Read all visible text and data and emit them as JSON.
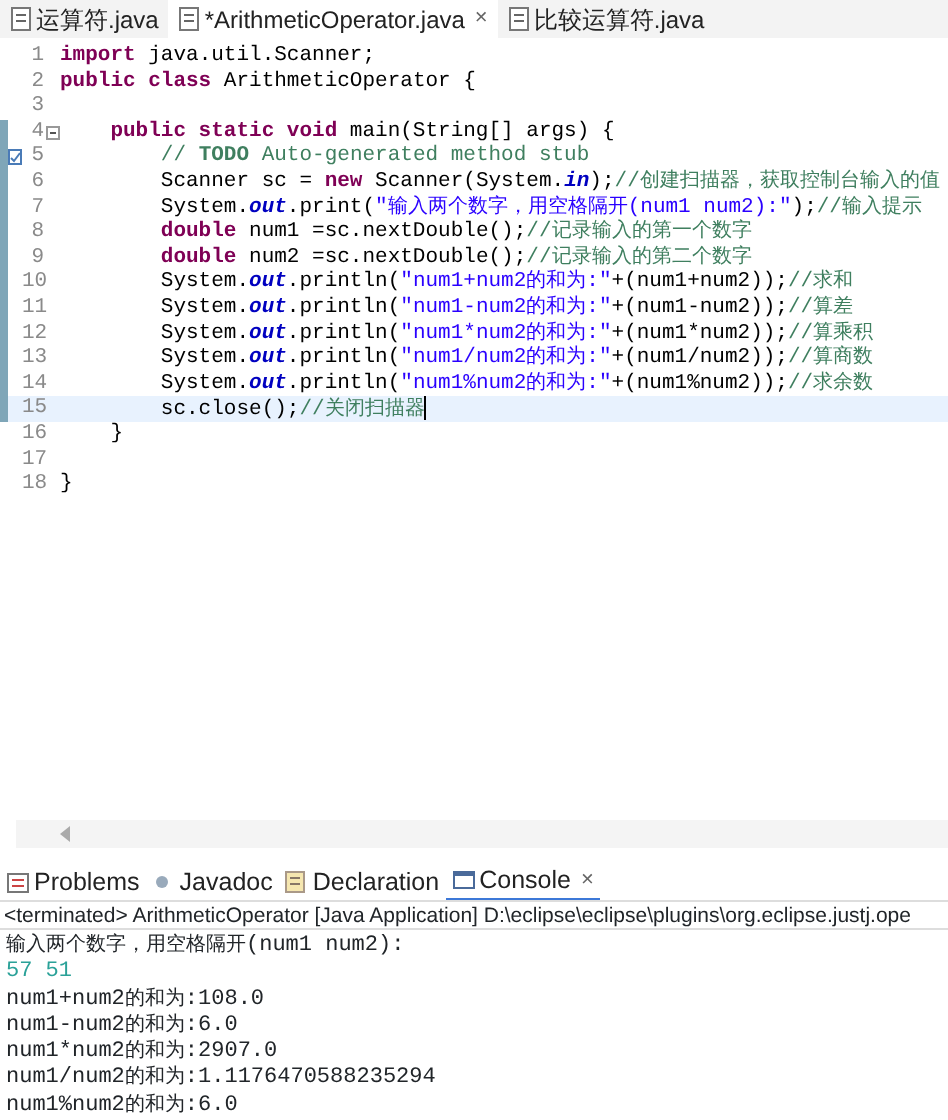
{
  "editor_tabs": [
    {
      "label": "运算符.java",
      "selected": false
    },
    {
      "label": "*ArithmeticOperator.java",
      "selected": true,
      "close": "×"
    },
    {
      "label": "比较运算符.java",
      "selected": false
    }
  ],
  "code_lines": [
    {
      "number": "1",
      "changed": false,
      "current": false,
      "fold": false,
      "task": false,
      "tokens": [
        {
          "kind": "keyword",
          "text": "import"
        },
        {
          "kind": "plain",
          "text": " java.util.Scanner;"
        }
      ]
    },
    {
      "number": "2",
      "changed": false,
      "current": false,
      "fold": false,
      "task": false,
      "tokens": [
        {
          "kind": "keyword",
          "text": "public class"
        },
        {
          "kind": "plain",
          "text": " ArithmeticOperator {"
        }
      ]
    },
    {
      "number": "3",
      "changed": false,
      "current": false,
      "fold": false,
      "task": false
    },
    {
      "number": "4",
      "changed": true,
      "current": false,
      "fold": true,
      "task": false,
      "tokens": [
        {
          "kind": "keyword",
          "text": "    public static void"
        },
        {
          "kind": "plain",
          "text": " main(String[] args) {"
        }
      ]
    },
    {
      "number": "5",
      "changed": true,
      "current": false,
      "fold": false,
      "task": true,
      "tokens": [
        {
          "kind": "comment",
          "text": "        // **TODO** Auto-generated method stub"
        }
      ]
    },
    {
      "number": "6",
      "changed": true,
      "current": false,
      "fold": false,
      "task": false,
      "tokens": [
        {
          "kind": "plain",
          "text": "        Scanner sc = "
        },
        {
          "kind": "keyword",
          "text": "new"
        },
        {
          "kind": "plain",
          "text": " Scanner(System."
        },
        {
          "kind": "field",
          "text": "in"
        },
        {
          "kind": "plain",
          "text": ");"
        },
        {
          "kind": "comment",
          "text": "//创建扫描器，获取控制台输入的值"
        }
      ]
    },
    {
      "number": "7",
      "changed": true,
      "current": false,
      "fold": false,
      "task": false,
      "tokens": [
        {
          "kind": "plain",
          "text": "        System."
        },
        {
          "kind": "field",
          "text": "out"
        },
        {
          "kind": "plain",
          "text": ".print("
        },
        {
          "kind": "string",
          "text": "\"输入两个数字，用空格隔开(num1 num2):\""
        },
        {
          "kind": "plain",
          "text": ");"
        },
        {
          "kind": "comment",
          "text": "//输入提示"
        }
      ]
    },
    {
      "number": "8",
      "changed": true,
      "current": false,
      "fold": false,
      "task": false,
      "tokens": [
        {
          "kind": "keyword",
          "text": "        double"
        },
        {
          "kind": "plain",
          "text": " num1 =sc.nextDouble();"
        },
        {
          "kind": "comment",
          "text": "//记录输入的第一个数字"
        }
      ]
    },
    {
      "number": "9",
      "changed": true,
      "current": false,
      "fold": false,
      "task": false,
      "tokens": [
        {
          "kind": "keyword",
          "text": "        double"
        },
        {
          "kind": "plain",
          "text": " num2 =sc.nextDouble();"
        },
        {
          "kind": "comment",
          "text": "//记录输入的第二个数字"
        }
      ]
    },
    {
      "number": "10",
      "changed": true,
      "current": false,
      "fold": false,
      "task": false,
      "tokens": [
        {
          "kind": "plain",
          "text": "        System."
        },
        {
          "kind": "field",
          "text": "out"
        },
        {
          "kind": "plain",
          "text": ".println("
        },
        {
          "kind": "string",
          "text": "\"num1+num2的和为:\""
        },
        {
          "kind": "plain",
          "text": "+(num1+num2));"
        },
        {
          "kind": "comment",
          "text": "//求和"
        }
      ]
    },
    {
      "number": "11",
      "changed": true,
      "current": false,
      "fold": false,
      "task": false,
      "tokens": [
        {
          "kind": "plain",
          "text": "        System."
        },
        {
          "kind": "field",
          "text": "out"
        },
        {
          "kind": "plain",
          "text": ".println("
        },
        {
          "kind": "string",
          "text": "\"num1-num2的和为:\""
        },
        {
          "kind": "plain",
          "text": "+(num1-num2));"
        },
        {
          "kind": "comment",
          "text": "//算差"
        }
      ]
    },
    {
      "number": "12",
      "changed": true,
      "current": false,
      "fold": false,
      "task": false,
      "tokens": [
        {
          "kind": "plain",
          "text": "        System."
        },
        {
          "kind": "field",
          "text": "out"
        },
        {
          "kind": "plain",
          "text": ".println("
        },
        {
          "kind": "string",
          "text": "\"num1*num2的和为:\""
        },
        {
          "kind": "plain",
          "text": "+(num1*num2));"
        },
        {
          "kind": "comment",
          "text": "//算乘积"
        }
      ]
    },
    {
      "number": "13",
      "changed": true,
      "current": false,
      "fold": false,
      "task": false,
      "tokens": [
        {
          "kind": "plain",
          "text": "        System."
        },
        {
          "kind": "field",
          "text": "out"
        },
        {
          "kind": "plain",
          "text": ".println("
        },
        {
          "kind": "string",
          "text": "\"num1/num2的和为:\""
        },
        {
          "kind": "plain",
          "text": "+(num1/num2));"
        },
        {
          "kind": "comment",
          "text": "//算商数"
        }
      ]
    },
    {
      "number": "14",
      "changed": true,
      "current": false,
      "fold": false,
      "task": false,
      "tokens": [
        {
          "kind": "plain",
          "text": "        System."
        },
        {
          "kind": "field",
          "text": "out"
        },
        {
          "kind": "plain",
          "text": ".println("
        },
        {
          "kind": "string",
          "text": "\"num1%num2的和为:\""
        },
        {
          "kind": "plain",
          "text": "+(num1%num2));"
        },
        {
          "kind": "comment",
          "text": "//求余数"
        }
      ]
    },
    {
      "number": "15",
      "changed": true,
      "current": true,
      "fold": false,
      "task": false,
      "tokens": [
        {
          "kind": "plain",
          "text": "        sc.close();"
        },
        {
          "kind": "comment",
          "text": "//关闭扫描器"
        }
      ]
    },
    {
      "number": "16",
      "changed": false,
      "current": false,
      "fold": false,
      "task": false,
      "tokens": [
        {
          "kind": "plain",
          "text": "    }"
        }
      ]
    },
    {
      "number": "17",
      "changed": false,
      "current": false,
      "fold": false,
      "task": false
    },
    {
      "number": "18",
      "changed": false,
      "current": false,
      "fold": false,
      "task": false,
      "tokens": [
        {
          "kind": "plain",
          "text": "}"
        }
      ]
    }
  ],
  "view_tabs": [
    {
      "label": "Problems",
      "selected": false
    },
    {
      "label": "Javadoc",
      "selected": false
    },
    {
      "label": "Declaration",
      "selected": false
    },
    {
      "label": "Console",
      "selected": true,
      "close": "×"
    }
  ],
  "console": {
    "status": "<terminated> ArithmeticOperator [Java Application] D:\\eclipse\\eclipse\\plugins\\org.eclipse.justj.ope",
    "lines": [
      {
        "kind": "output",
        "text": "输入两个数字，用空格隔开(num1 num2):"
      },
      {
        "kind": "input",
        "text": "57 51"
      },
      {
        "kind": "output",
        "text": "num1+num2的和为:108.0"
      },
      {
        "kind": "output",
        "text": "num1-num2的和为:6.0"
      },
      {
        "kind": "output",
        "text": "num1*num2的和为:2907.0"
      },
      {
        "kind": "output",
        "text": "num1/num2的和为:1.1176470588235294"
      },
      {
        "kind": "output",
        "text": "num1%num2的和为:6.0"
      }
    ]
  }
}
